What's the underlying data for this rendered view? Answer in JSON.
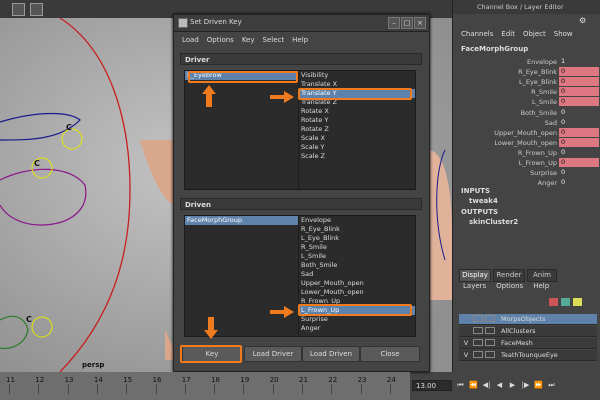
{
  "viewport": {
    "camera_label": "persp",
    "cluster_labels": [
      "C",
      "C",
      "C"
    ]
  },
  "dialog": {
    "title": "Set Driven Key",
    "menu": [
      "Load",
      "Options",
      "Key",
      "Select",
      "Help"
    ],
    "driver": {
      "section_label": "Driver",
      "objects": [
        "L_Eyebrow"
      ],
      "selected_object": "L_Eyebrow",
      "attributes": [
        "Visibility",
        "Translate X",
        "Translate Y",
        "Translate Z",
        "Rotate X",
        "Rotate Y",
        "Rotate Z",
        "Scale X",
        "Scale Y",
        "Scale Z"
      ],
      "selected_attribute": "Translate Y"
    },
    "driven": {
      "section_label": "Driven",
      "objects": [
        "FaceMorphGroup"
      ],
      "selected_object": "FaceMorphGroup",
      "attributes": [
        "Envelope",
        "R_Eye_Blink",
        "L_Eye_Blink",
        "R_Smile",
        "L_Smile",
        "Both_Smile",
        "Sad",
        "Upper_Mouth_open",
        "Lower_Mouth_open",
        "R_Frown_Up",
        "L_Frown_Up",
        "Surprise",
        "Anger"
      ],
      "selected_attribute": "L_Frown_Up"
    },
    "buttons": {
      "key": "Key",
      "load_driver": "Load Driver",
      "load_driven": "Load Driven",
      "close": "Close"
    },
    "highlight_color": "#f07a1e"
  },
  "channel_box": {
    "title": "Channel Box / Layer Editor",
    "menu": [
      "Channels",
      "Edit",
      "Object",
      "Show"
    ],
    "object_name": "FaceMorphGroup",
    "attributes": [
      {
        "name": "Envelope",
        "value": "1",
        "keyed": false
      },
      {
        "name": "R_Eye_Blink",
        "value": "0",
        "keyed": true
      },
      {
        "name": "L_Eye_Blink",
        "value": "0",
        "keyed": true
      },
      {
        "name": "R_Smile",
        "value": "0",
        "keyed": true
      },
      {
        "name": "L_Smile",
        "value": "0",
        "keyed": true
      },
      {
        "name": "Both_Smile",
        "value": "0",
        "keyed": false
      },
      {
        "name": "Sad",
        "value": "0",
        "keyed": false
      },
      {
        "name": "Upper_Mouth_open",
        "value": "0",
        "keyed": true
      },
      {
        "name": "Lower_Mouth_open",
        "value": "0",
        "keyed": true
      },
      {
        "name": "R_Frown_Up",
        "value": "0",
        "keyed": false
      },
      {
        "name": "L_Frown_Up",
        "value": "0",
        "keyed": true
      },
      {
        "name": "Surprise",
        "value": "0",
        "keyed": false
      },
      {
        "name": "Anger",
        "value": "0",
        "keyed": false
      }
    ],
    "keyed_color": "#dd7882",
    "inputs_label": "INPUTS",
    "inputs": [
      "tweak4"
    ],
    "outputs_label": "OUTPUTS",
    "outputs": [
      "skinCluster2"
    ]
  },
  "layer_editor": {
    "tabs": [
      "Display",
      "Render",
      "Anim"
    ],
    "active_tab": "Display",
    "menu": [
      "Layers",
      "Options",
      "Help"
    ],
    "layers": [
      {
        "name": "MorpsObjects",
        "visible": "",
        "selected": true
      },
      {
        "name": "AllClusters",
        "visible": "",
        "selected": false
      },
      {
        "name": "FaceMesh",
        "visible": "V",
        "selected": false
      },
      {
        "name": "TeathTounqueEye",
        "visible": "V",
        "selected": false
      }
    ]
  },
  "timeline": {
    "ticks": [
      "11",
      "12",
      "13",
      "14",
      "15",
      "16",
      "17",
      "18",
      "19",
      "20",
      "21",
      "22",
      "23",
      "24"
    ],
    "current_time": "13.00"
  }
}
